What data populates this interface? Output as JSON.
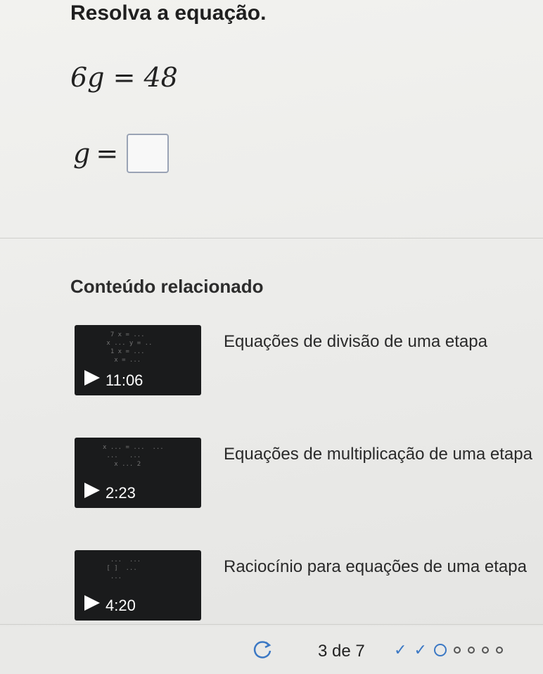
{
  "problem": {
    "title": "Resolva a equação.",
    "equation": "6g = 48",
    "answer_variable": "g",
    "answer_equals": "=",
    "answer_value": ""
  },
  "related": {
    "heading": "Conteúdo relacionado",
    "videos": [
      {
        "title": "Equações de divisão de uma etapa",
        "duration": "11:06"
      },
      {
        "title": "Equações de multiplicação de uma etapa",
        "duration": "2:23"
      },
      {
        "title": "Raciocínio para equações de uma etapa",
        "duration": "4:20"
      }
    ]
  },
  "footer": {
    "progress": "3 de 7",
    "completed": 2,
    "current": 3,
    "total": 7,
    "accent_color": "#3b78c4",
    "retry_icon": "retry-icon"
  }
}
